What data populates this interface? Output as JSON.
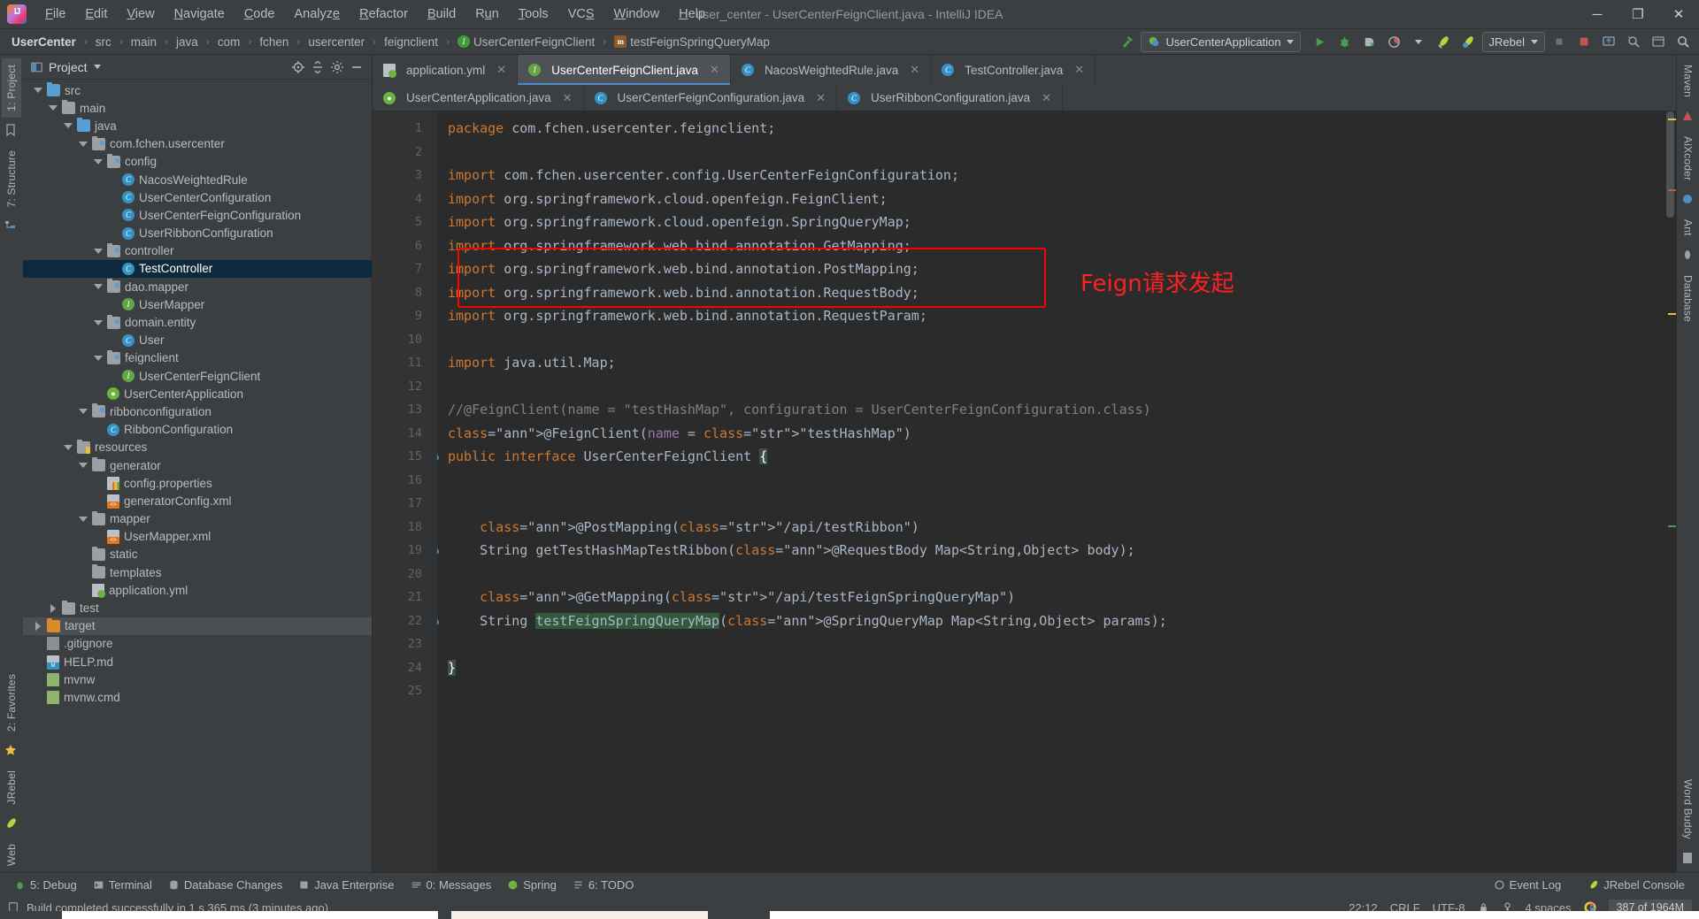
{
  "window": {
    "title": "user_center - UserCenterFeignClient.java - IntelliJ IDEA",
    "minimize": "─",
    "maximize": "❐",
    "close": "✕"
  },
  "menu": {
    "items": [
      "File",
      "Edit",
      "View",
      "Navigate",
      "Code",
      "Analyze",
      "Refactor",
      "Build",
      "Run",
      "Tools",
      "VCS",
      "Window",
      "Help"
    ]
  },
  "navbar": {
    "crumbs": [
      "UserCenter",
      "src",
      "main",
      "java",
      "com",
      "fchen",
      "usercenter",
      "feignclient",
      "UserCenterFeignClient",
      "testFeignSpringQueryMap"
    ],
    "run_config": "UserCenterApplication",
    "jrebel_label": "JRebel",
    "icons": [
      "hammer-build-icon",
      "run-icon",
      "debug-icon",
      "run-with-coverage-icon",
      "profiler-icon",
      "jrebel-run-icon",
      "jrebel-debug-icon",
      "stop-icon",
      "update-icon",
      "search-everywhere-icon",
      "settings-icon",
      "search-icon"
    ]
  },
  "project_panel": {
    "title": "Project",
    "header_icons": [
      "locate-icon",
      "collapse-all-icon",
      "settings-icon",
      "hide-icon"
    ],
    "tree": [
      {
        "label": "src",
        "depth": 1,
        "type": "folder-src",
        "twisty": "open"
      },
      {
        "label": "main",
        "depth": 2,
        "type": "folder",
        "twisty": "open"
      },
      {
        "label": "java",
        "depth": 3,
        "type": "folder-src",
        "twisty": "open"
      },
      {
        "label": "com.fchen.usercenter",
        "depth": 4,
        "type": "package",
        "twisty": "open"
      },
      {
        "label": "config",
        "depth": 5,
        "type": "package",
        "twisty": "open"
      },
      {
        "label": "NacosWeightedRule",
        "depth": 6,
        "type": "class"
      },
      {
        "label": "UserCenterConfiguration",
        "depth": 6,
        "type": "class"
      },
      {
        "label": "UserCenterFeignConfiguration",
        "depth": 6,
        "type": "class"
      },
      {
        "label": "UserRibbonConfiguration",
        "depth": 6,
        "type": "class"
      },
      {
        "label": "controller",
        "depth": 5,
        "type": "package",
        "twisty": "open"
      },
      {
        "label": "TestController",
        "depth": 6,
        "type": "class",
        "selected": true
      },
      {
        "label": "dao.mapper",
        "depth": 5,
        "type": "package",
        "twisty": "open"
      },
      {
        "label": "UserMapper",
        "depth": 6,
        "type": "interface"
      },
      {
        "label": "domain.entity",
        "depth": 5,
        "type": "package",
        "twisty": "open"
      },
      {
        "label": "User",
        "depth": 6,
        "type": "class"
      },
      {
        "label": "feignclient",
        "depth": 5,
        "type": "package",
        "twisty": "open"
      },
      {
        "label": "UserCenterFeignClient",
        "depth": 6,
        "type": "interface"
      },
      {
        "label": "UserCenterApplication",
        "depth": 5,
        "type": "spring-class"
      },
      {
        "label": "ribbonconfiguration",
        "depth": 4,
        "type": "package",
        "twisty": "open"
      },
      {
        "label": "RibbonConfiguration",
        "depth": 5,
        "type": "class"
      },
      {
        "label": "resources",
        "depth": 3,
        "type": "folder-res",
        "twisty": "open"
      },
      {
        "label": "generator",
        "depth": 4,
        "type": "folder",
        "twisty": "open"
      },
      {
        "label": "config.properties",
        "depth": 5,
        "type": "file-properties"
      },
      {
        "label": "generatorConfig.xml",
        "depth": 5,
        "type": "file-xml"
      },
      {
        "label": "mapper",
        "depth": 4,
        "type": "folder",
        "twisty": "open"
      },
      {
        "label": "UserMapper.xml",
        "depth": 5,
        "type": "file-xml"
      },
      {
        "label": "static",
        "depth": 4,
        "type": "folder"
      },
      {
        "label": "templates",
        "depth": 4,
        "type": "folder"
      },
      {
        "label": "application.yml",
        "depth": 4,
        "type": "file-yml"
      },
      {
        "label": "test",
        "depth": 2,
        "type": "folder",
        "twisty": "closed"
      },
      {
        "label": "target",
        "depth": 1,
        "type": "folder-target",
        "twisty": "closed",
        "hovered": true
      },
      {
        "label": ".gitignore",
        "depth": 1,
        "type": "file-git"
      },
      {
        "label": "HELP.md",
        "depth": 1,
        "type": "file-md"
      },
      {
        "label": "mvnw",
        "depth": 1,
        "type": "file-sh"
      },
      {
        "label": "mvnw.cmd",
        "depth": 1,
        "type": "file-sh"
      }
    ]
  },
  "left_rail": {
    "top": [
      "1: Project"
    ],
    "bottom": [
      "2: Favorites",
      "JRebel",
      "Web"
    ],
    "structure": "7: Structure"
  },
  "right_rail": {
    "items": [
      "Maven",
      "AiXcoder",
      "Ant",
      "Database",
      "Word Buddy"
    ]
  },
  "editor": {
    "tabs_row1": [
      {
        "label": "application.yml",
        "icon": "yml-icon",
        "active": false,
        "closable": true
      },
      {
        "label": "UserCenterFeignClient.java",
        "icon": "interface-icon",
        "active": true,
        "closable": true
      },
      {
        "label": "NacosWeightedRule.java",
        "icon": "class-icon",
        "active": false,
        "closable": true
      },
      {
        "label": "TestController.java",
        "icon": "class-icon",
        "active": false,
        "closable": true
      }
    ],
    "tabs_row2": [
      {
        "label": "UserCenterApplication.java",
        "icon": "spring-icon",
        "active": false,
        "closable": true
      },
      {
        "label": "UserCenterFeignConfiguration.java",
        "icon": "class-icon",
        "active": false,
        "closable": true
      },
      {
        "label": "UserRibbonConfiguration.java",
        "icon": "class-icon",
        "active": false,
        "closable": true
      }
    ],
    "line_numbers": [
      "1",
      "2",
      "3",
      "4",
      "5",
      "6",
      "7",
      "8",
      "9",
      "10",
      "11",
      "12",
      "13",
      "14",
      "15",
      "16",
      "17",
      "18",
      "19",
      "20",
      "21",
      "22",
      "23",
      "24",
      "25"
    ],
    "code_lines": [
      "package com.fchen.usercenter.feignclient;",
      "",
      "import com.fchen.usercenter.config.UserCenterFeignConfiguration;",
      "import org.springframework.cloud.openfeign.FeignClient;",
      "import org.springframework.cloud.openfeign.SpringQueryMap;",
      "import org.springframework.web.bind.annotation.GetMapping;",
      "import org.springframework.web.bind.annotation.PostMapping;",
      "import org.springframework.web.bind.annotation.RequestBody;",
      "import org.springframework.web.bind.annotation.RequestParam;",
      "",
      "import java.util.Map;",
      "",
      "//@FeignClient(name = \"testHashMap\", configuration = UserCenterFeignConfiguration.class)",
      "@FeignClient(name = \"testHashMap\")",
      "public interface UserCenterFeignClient {",
      "",
      "",
      "    @PostMapping(\"/api/testRibbon\")",
      "    String getTestHashMapTestRibbon(@RequestBody Map<String,Object> body);",
      "",
      "    @GetMapping(\"/api/testFeignSpringQueryMap\")",
      "    String testFeignSpringQueryMap(@SpringQueryMap Map<String,Object> params);",
      "",
      "}",
      ""
    ],
    "annotation_text": "Feign请求发起",
    "annotation_color": "#ff2020",
    "highlight_box_color": "#ff0000"
  },
  "tool_window_bar": {
    "left": [
      {
        "label": "5: Debug",
        "icon": "debug-icon"
      },
      {
        "label": "Terminal",
        "icon": "terminal-icon"
      },
      {
        "label": "Database Changes",
        "icon": "database-icon"
      },
      {
        "label": "Java Enterprise",
        "icon": "java-icon"
      },
      {
        "label": "0: Messages",
        "icon": "messages-icon"
      },
      {
        "label": "Spring",
        "icon": "spring-icon"
      },
      {
        "label": "6: TODO",
        "icon": "todo-icon"
      }
    ],
    "right": [
      {
        "label": "Event Log",
        "icon": "event-log-icon"
      },
      {
        "label": "JRebel Console",
        "icon": "jrebel-icon"
      }
    ]
  },
  "status_bar": {
    "message": "Build completed successfully in 1 s 365 ms (3 minutes ago)",
    "caret_position": "22:12",
    "line_separator": "CRLF",
    "encoding": "UTF-8",
    "indent": "4 spaces",
    "memory": "387 of 1964M",
    "lock_icon": "lock-icon",
    "inspection_icon": "inspection-icon",
    "google_icon": "google-icon"
  }
}
